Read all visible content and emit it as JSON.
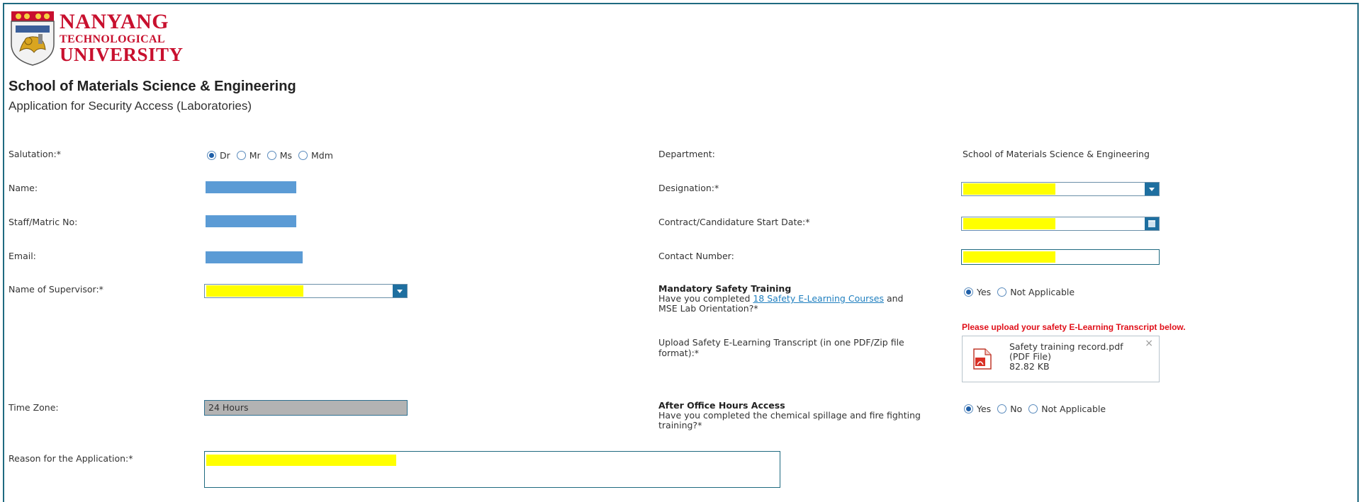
{
  "header": {
    "logo_line1": "NANYANG",
    "logo_line2": "TECHNOLOGICAL",
    "logo_line3": "UNIVERSITY",
    "school": "School of Materials Science & Engineering",
    "form_title": "Application for Security Access (Laboratories)"
  },
  "form": {
    "salutation": {
      "label": "Salutation:",
      "required": "*",
      "options": [
        "Dr",
        "Mr",
        "Ms",
        "Mdm"
      ],
      "selected": "Dr"
    },
    "name": {
      "label": "Name:"
    },
    "staff_no": {
      "label": "Staff/Matric No:"
    },
    "email": {
      "label": "Email:"
    },
    "supervisor": {
      "label": "Name of Supervisor:",
      "required": "*"
    },
    "time_zone": {
      "label": "Time Zone:",
      "value": "24 Hours"
    },
    "reason": {
      "label": "Reason for the Application:",
      "required": "*"
    },
    "department": {
      "label": "Department:",
      "value": "School of Materials Science & Engineering"
    },
    "designation": {
      "label": "Designation:",
      "required": "*"
    },
    "start_date": {
      "label": "Contract/Candidature Start Date:",
      "required": "*"
    },
    "contact": {
      "label": "Contact Number:"
    },
    "safety_training": {
      "heading": "Mandatory Safety Training",
      "question_pre": "Have you completed ",
      "link": "18 Safety E-Learning Courses",
      "question_post": " and MSE Lab Orientation?",
      "required": "*",
      "options": [
        "Yes",
        "Not Applicable"
      ],
      "selected": "Yes"
    },
    "upload": {
      "label": "Upload Safety E-Learning Transcript (in one PDF/Zip file format):",
      "required": "*",
      "warning": "Please upload your safety E-Learning Transcript below.",
      "file_name": "Safety training record.pdf",
      "file_type": "(PDF File)",
      "file_size": "82.82 KB",
      "close_symbol": "×"
    },
    "after_hours": {
      "heading": "After Office Hours Access",
      "question": "Have you completed the chemical spillage and fire fighting training?",
      "required": "*",
      "options": [
        "Yes",
        "No",
        "Not Applicable"
      ],
      "selected": "Yes"
    }
  },
  "colors": {
    "border": "#1f6a80",
    "redaction_blue": "#5b9bd5",
    "redaction_yellow": "#ffff00",
    "warning_red": "#e0101a",
    "brand_red": "#c8102e"
  }
}
